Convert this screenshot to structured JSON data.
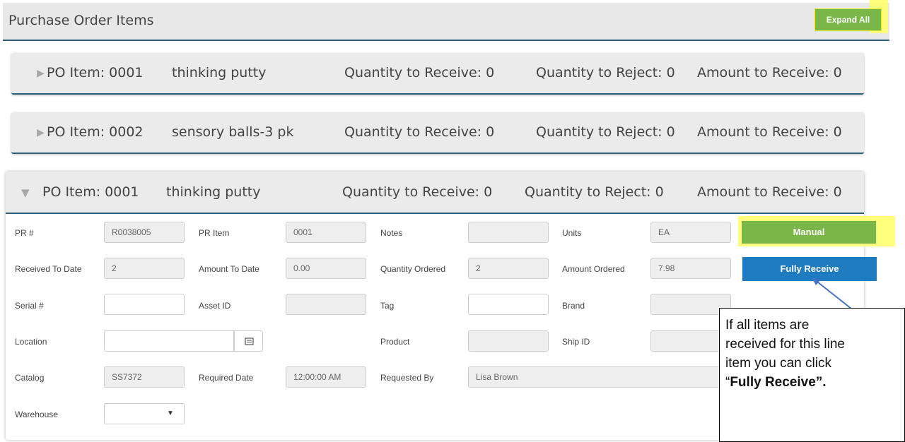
{
  "header": {
    "title": "Purchase Order Items",
    "expand_all": "Expand All"
  },
  "collapsed_items": [
    {
      "item": "PO Item: 0001",
      "desc": "thinking putty",
      "qty_receive": "Quantity to Receive: 0",
      "qty_reject": "Quantity to Reject: 0",
      "amount": "Amount to Receive: 0"
    },
    {
      "item": "PO Item: 0002",
      "desc": "sensory balls-3 pk",
      "qty_receive": "Quantity to Receive: 0",
      "qty_reject": "Quantity to Reject: 0",
      "amount": "Amount to Receive: 0"
    }
  ],
  "expanded_item": {
    "item": "PO Item: 0001",
    "desc": "thinking putty",
    "qty_receive": "Quantity to Receive: 0",
    "qty_reject": "Quantity to Reject: 0",
    "amount": "Amount to Receive: 0",
    "labels": {
      "pr_num": "PR #",
      "pr_item": "PR Item",
      "notes": "Notes",
      "units": "Units",
      "received_to_date": "Received To Date",
      "amount_to_date": "Amount To Date",
      "quantity_ordered": "Quantity Ordered",
      "amount_ordered": "Amount Ordered",
      "serial": "Serial #",
      "asset_id": "Asset ID",
      "tag": "Tag",
      "brand": "Brand",
      "location": "Location",
      "product": "Product",
      "ship_id": "Ship ID",
      "catalog": "Catalog",
      "required_date": "Required Date",
      "requested_by": "Requested By",
      "warehouse": "Warehouse"
    },
    "values": {
      "pr_num": "R0038005",
      "pr_item": "0001",
      "notes": "",
      "units": "EA",
      "received_to_date": "2",
      "amount_to_date": "0.00",
      "quantity_ordered": "2",
      "amount_ordered": "7.98",
      "serial": "",
      "asset_id": "",
      "tag": "",
      "brand": "",
      "location": "",
      "product": "",
      "ship_id": "",
      "catalog": "SS7372",
      "required_date": "12:00:00 AM",
      "requested_by": "Lisa Brown",
      "warehouse": ""
    },
    "buttons": {
      "manual": "Manual",
      "fully_receive": "Fully Receive"
    }
  },
  "callout": {
    "line1": "If all items are",
    "line2": "received for this line",
    "line3": "item you can click",
    "quote_open": "“",
    "bold": "Fully Receive”."
  },
  "colors": {
    "accent_green": "#7ab648",
    "accent_blue": "#1f7bbf",
    "highlight": "#ffff66",
    "divider": "#2e5f78"
  }
}
